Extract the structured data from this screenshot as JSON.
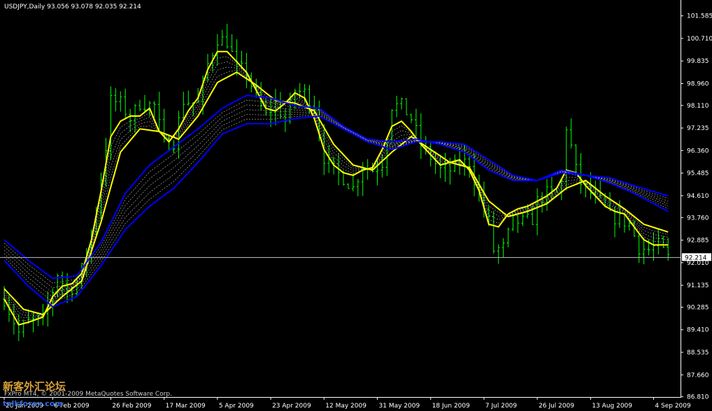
{
  "header": {
    "symbol": "USDJPY,Daily",
    "ohlc": "93.056 93.078 92.035 92.214"
  },
  "footer": {
    "copyright": "FxPro MT4, © 2001-2009 MetaQuotes Software Corp.",
    "watermark_cn": "新客外汇论坛",
    "watermark_url": "talkforex.com"
  },
  "colors": {
    "background": "#000000",
    "candles": "#00ff00",
    "fast_ma": "#ffff00",
    "slow_ma": "#0000ff",
    "ribbon": "#ffffff",
    "axis": "#ffffff"
  },
  "chart_data": {
    "type": "line",
    "title": "USDJPY,Daily",
    "price_line": 92.214,
    "ylim": [
      86.8,
      102.2
    ],
    "y_ticks": [
      "101.585",
      "100.710",
      "99.835",
      "98.960",
      "98.110",
      "97.235",
      "96.360",
      "95.485",
      "94.610",
      "93.760",
      "92.885",
      "92.010",
      "91.135",
      "90.285",
      "89.410",
      "88.535",
      "87.660",
      "86.810"
    ],
    "x_ticks": [
      "20 Jan 2009",
      "6 Feb 2009",
      "26 Feb 2009",
      "17 Mar 2009",
      "5 Apr 2009",
      "23 Apr 2009",
      "12 May 2009",
      "31 May 2009",
      "18 Jun 2009",
      "7 Jul 2009",
      "26 Jul 2009",
      "13 Aug 2009",
      "4 Sep 2009"
    ],
    "x_tick_index": [
      0,
      10,
      22,
      33,
      44,
      55,
      66,
      77,
      88,
      99,
      110,
      121,
      134
    ],
    "bars": {
      "count": 138,
      "keypoints": [
        [
          0,
          90.6
        ],
        [
          3,
          89.3
        ],
        [
          5,
          89.7
        ],
        [
          8,
          89.8
        ],
        [
          10,
          90.9
        ],
        [
          11,
          91.6
        ],
        [
          13,
          90.9
        ],
        [
          15,
          91.2
        ],
        [
          17,
          92.3
        ],
        [
          19,
          94.1
        ],
        [
          21,
          96.5
        ],
        [
          22,
          98.3
        ],
        [
          24,
          98.2
        ],
        [
          26,
          97.6
        ],
        [
          28,
          98.2
        ],
        [
          31,
          98.1
        ],
        [
          33,
          96.6
        ],
        [
          35,
          96.7
        ],
        [
          37,
          98.3
        ],
        [
          40,
          98.2
        ],
        [
          42,
          99.7
        ],
        [
          44,
          100.7
        ],
        [
          46,
          100.6
        ],
        [
          48,
          99.6
        ],
        [
          50,
          99.4
        ],
        [
          52,
          98.4
        ],
        [
          54,
          97.7
        ],
        [
          56,
          98.2
        ],
        [
          58,
          97.5
        ],
        [
          60,
          98.7
        ],
        [
          62,
          98.6
        ],
        [
          64,
          98.1
        ],
        [
          66,
          96.1
        ],
        [
          68,
          95.6
        ],
        [
          70,
          95.3
        ],
        [
          72,
          94.9
        ],
        [
          74,
          95.8
        ],
        [
          76,
          95.6
        ],
        [
          78,
          95.9
        ],
        [
          80,
          98.1
        ],
        [
          82,
          98.1
        ],
        [
          84,
          97.6
        ],
        [
          86,
          96.6
        ],
        [
          88,
          96.1
        ],
        [
          90,
          95.6
        ],
        [
          92,
          95.6
        ],
        [
          94,
          95.9
        ],
        [
          96,
          95.9
        ],
        [
          98,
          94.6
        ],
        [
          100,
          93.6
        ],
        [
          101,
          92.5
        ],
        [
          103,
          92.6
        ],
        [
          105,
          93.6
        ],
        [
          107,
          93.6
        ],
        [
          109,
          93.7
        ],
        [
          110,
          94.4
        ],
        [
          112,
          94.7
        ],
        [
          114,
          94.7
        ],
        [
          115,
          95.1
        ],
        [
          116,
          97.3
        ],
        [
          117,
          96.5
        ],
        [
          118,
          95.6
        ],
        [
          119,
          95.1
        ],
        [
          121,
          94.7
        ],
        [
          123,
          94.4
        ],
        [
          125,
          93.8
        ],
        [
          127,
          93.7
        ],
        [
          129,
          93.5
        ],
        [
          131,
          92.6
        ],
        [
          133,
          92.5
        ],
        [
          135,
          92.7
        ],
        [
          137,
          92.2
        ]
      ],
      "noise_amp": 0.55
    },
    "series": [
      {
        "color": "#ffff00",
        "keypoints": [
          [
            0,
            90.6
          ],
          [
            3,
            89.6
          ],
          [
            5,
            89.7
          ],
          [
            8,
            89.9
          ],
          [
            10,
            90.7
          ],
          [
            12,
            91.1
          ],
          [
            14,
            91.2
          ],
          [
            16,
            91.6
          ],
          [
            18,
            92.9
          ],
          [
            20,
            94.8
          ],
          [
            22,
            96.9
          ],
          [
            24,
            97.5
          ],
          [
            26,
            97.7
          ],
          [
            28,
            97.7
          ],
          [
            30,
            98.0
          ],
          [
            32,
            97.1
          ],
          [
            34,
            96.7
          ],
          [
            36,
            97.2
          ],
          [
            38,
            97.9
          ],
          [
            40,
            98.4
          ],
          [
            42,
            99.5
          ],
          [
            44,
            100.2
          ],
          [
            46,
            100.2
          ],
          [
            48,
            99.8
          ],
          [
            50,
            99.4
          ],
          [
            52,
            98.7
          ],
          [
            54,
            98.0
          ],
          [
            56,
            97.9
          ],
          [
            58,
            98.2
          ],
          [
            60,
            98.6
          ],
          [
            62,
            98.4
          ],
          [
            64,
            97.6
          ],
          [
            66,
            96.4
          ],
          [
            68,
            95.8
          ],
          [
            70,
            95.5
          ],
          [
            72,
            95.4
          ],
          [
            74,
            95.6
          ],
          [
            76,
            95.7
          ],
          [
            78,
            96.4
          ],
          [
            80,
            97.3
          ],
          [
            82,
            97.5
          ],
          [
            84,
            97.1
          ],
          [
            86,
            96.6
          ],
          [
            88,
            96.2
          ],
          [
            90,
            95.8
          ],
          [
            92,
            95.9
          ],
          [
            94,
            96.0
          ],
          [
            96,
            95.6
          ],
          [
            98,
            94.8
          ],
          [
            100,
            93.5
          ],
          [
            102,
            93.4
          ],
          [
            104,
            93.9
          ],
          [
            106,
            94.1
          ],
          [
            108,
            94.2
          ],
          [
            110,
            94.4
          ],
          [
            112,
            94.6
          ],
          [
            114,
            94.9
          ],
          [
            116,
            95.6
          ],
          [
            118,
            95.5
          ],
          [
            120,
            95.0
          ],
          [
            122,
            94.6
          ],
          [
            124,
            94.2
          ],
          [
            126,
            94.0
          ],
          [
            128,
            93.9
          ],
          [
            130,
            93.4
          ],
          [
            132,
            92.9
          ],
          [
            134,
            92.7
          ],
          [
            137,
            92.7
          ]
        ]
      },
      {
        "color": "#ffff00",
        "keypoints": [
          [
            0,
            91.0
          ],
          [
            4,
            90.2
          ],
          [
            8,
            90.0
          ],
          [
            12,
            90.7
          ],
          [
            16,
            91.3
          ],
          [
            20,
            93.6
          ],
          [
            24,
            96.3
          ],
          [
            28,
            97.2
          ],
          [
            32,
            97.1
          ],
          [
            36,
            96.8
          ],
          [
            40,
            97.7
          ],
          [
            44,
            99.0
          ],
          [
            48,
            99.4
          ],
          [
            52,
            98.9
          ],
          [
            56,
            98.3
          ],
          [
            60,
            98.2
          ],
          [
            64,
            97.9
          ],
          [
            68,
            96.6
          ],
          [
            72,
            95.8
          ],
          [
            76,
            95.6
          ],
          [
            80,
            96.3
          ],
          [
            84,
            96.9
          ],
          [
            88,
            96.4
          ],
          [
            92,
            95.9
          ],
          [
            96,
            95.7
          ],
          [
            100,
            94.4
          ],
          [
            104,
            93.8
          ],
          [
            108,
            94.0
          ],
          [
            112,
            94.3
          ],
          [
            116,
            94.9
          ],
          [
            120,
            95.2
          ],
          [
            124,
            94.6
          ],
          [
            128,
            94.1
          ],
          [
            132,
            93.5
          ],
          [
            137,
            93.2
          ]
        ]
      },
      {
        "color": "#0000ff",
        "keypoints": [
          [
            0,
            92.9
          ],
          [
            5,
            92.1
          ],
          [
            10,
            91.4
          ],
          [
            15,
            91.5
          ],
          [
            20,
            92.8
          ],
          [
            25,
            94.7
          ],
          [
            30,
            95.8
          ],
          [
            35,
            96.5
          ],
          [
            40,
            97.2
          ],
          [
            45,
            98.0
          ],
          [
            50,
            98.5
          ],
          [
            55,
            98.4
          ],
          [
            60,
            98.1
          ],
          [
            65,
            98.0
          ],
          [
            70,
            97.3
          ],
          [
            75,
            96.8
          ],
          [
            80,
            96.7
          ],
          [
            85,
            96.8
          ],
          [
            90,
            96.6
          ],
          [
            95,
            96.3
          ],
          [
            100,
            95.6
          ],
          [
            105,
            95.2
          ],
          [
            110,
            95.2
          ],
          [
            115,
            95.6
          ],
          [
            120,
            95.4
          ],
          [
            125,
            95.1
          ],
          [
            130,
            94.7
          ],
          [
            137,
            94.0
          ]
        ]
      },
      {
        "color": "#0000ff",
        "keypoints": [
          [
            0,
            92.1
          ],
          [
            5,
            91.1
          ],
          [
            10,
            90.3
          ],
          [
            15,
            90.7
          ],
          [
            20,
            91.9
          ],
          [
            25,
            93.3
          ],
          [
            30,
            94.2
          ],
          [
            35,
            94.9
          ],
          [
            40,
            95.9
          ],
          [
            45,
            97.0
          ],
          [
            50,
            97.4
          ],
          [
            55,
            97.4
          ],
          [
            60,
            97.6
          ],
          [
            65,
            97.7
          ],
          [
            70,
            97.2
          ],
          [
            75,
            96.7
          ],
          [
            80,
            96.4
          ],
          [
            85,
            96.7
          ],
          [
            90,
            96.7
          ],
          [
            95,
            96.6
          ],
          [
            100,
            96.0
          ],
          [
            105,
            95.4
          ],
          [
            110,
            95.2
          ],
          [
            115,
            95.5
          ],
          [
            120,
            95.4
          ],
          [
            125,
            95.3
          ],
          [
            130,
            95.0
          ],
          [
            137,
            94.6
          ]
        ]
      }
    ],
    "ribbon": [
      {
        "from": 0,
        "to": 1,
        "lines": 4
      },
      {
        "from": 2,
        "to": 3,
        "lines": 5
      }
    ]
  }
}
